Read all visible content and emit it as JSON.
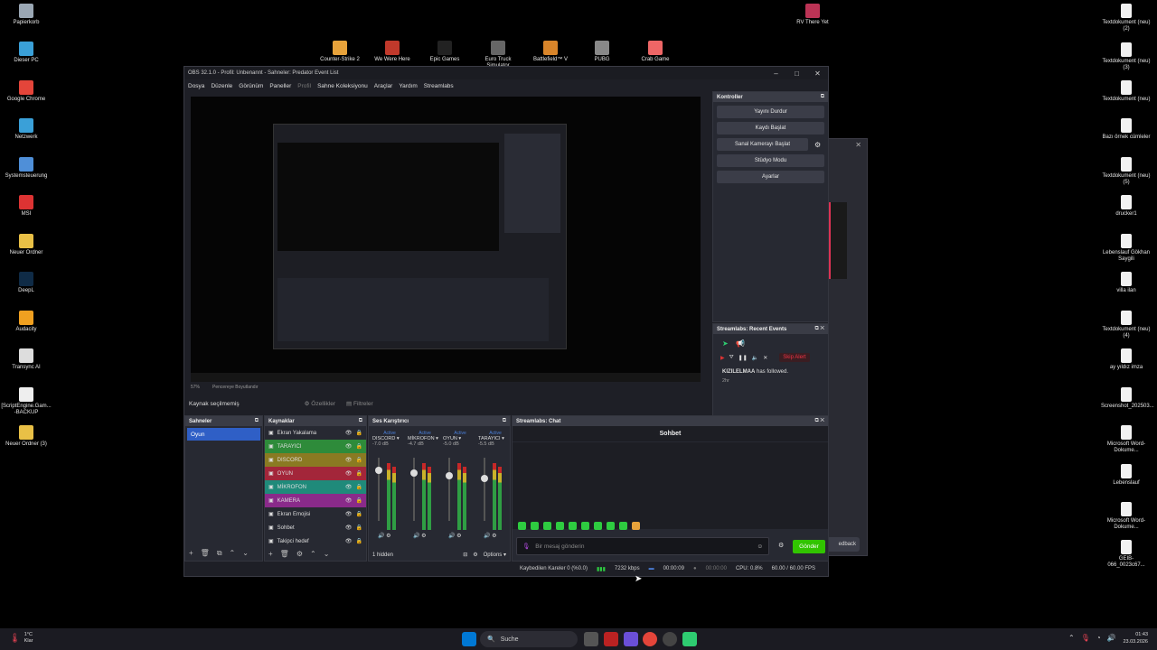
{
  "desktop": {
    "left_icons": [
      {
        "label": "Papierkorb",
        "color": "#9aa7b4"
      },
      {
        "label": "Dieser PC",
        "color": "#3aa0d8"
      },
      {
        "label": "Google Chrome",
        "color": "#e4453a"
      },
      {
        "label": "Netzwerk",
        "color": "#3aa0d8"
      },
      {
        "label": "Systemsteuerung",
        "color": "#4f8fd8"
      },
      {
        "label": "MSI",
        "color": "#d33"
      },
      {
        "label": "Neuer Ordner",
        "color": "#e9c046"
      },
      {
        "label": "DeepL",
        "color": "#0f2b46"
      },
      {
        "label": "Audacity",
        "color": "#f0a020"
      },
      {
        "label": "Transync AI",
        "color": "#ddd"
      },
      {
        "label": "[ScriptEngine.Gam... -BACKUP",
        "color": "#eee"
      },
      {
        "label": "Neuer Ordner (3)",
        "color": "#e9c046"
      }
    ],
    "top_icons": [
      {
        "label": "Counter-Strike 2",
        "color": "#e8a33b"
      },
      {
        "label": "We Were Here",
        "color": "#c0392b"
      },
      {
        "label": "Epic Games",
        "color": "#222"
      },
      {
        "label": "Euro Truck Simulator",
        "color": "#666"
      },
      {
        "label": "Battlefield™ V",
        "color": "#d9852a"
      },
      {
        "label": "PUBG",
        "color": "#888"
      },
      {
        "label": "Crab Game",
        "color": "#e66"
      }
    ],
    "rv_icon": {
      "label": "RV There Yet",
      "color": "#b35"
    },
    "right_icons": [
      {
        "label": "Textdokument (neu) (2)"
      },
      {
        "label": "Textdokument (neu) (3)"
      },
      {
        "label": "Textdokument (neu)"
      },
      {
        "label": "Bazı örnek cümleler"
      },
      {
        "label": "Textdokument (neu) (5)"
      },
      {
        "label": "drucker1"
      },
      {
        "label": "Lebenslauf Gökhan Saygili"
      },
      {
        "label": "villa ilan"
      },
      {
        "label": "Textdokument (neu) (4)"
      },
      {
        "label": "ay yıldız imza"
      },
      {
        "label": "Screenshot_202503..."
      },
      {
        "label": "Microsoft Word-Dokume..."
      },
      {
        "label": "Lebenslauf"
      },
      {
        "label": "Microsoft Word-Dokume..."
      },
      {
        "label": "GEIB-066_0023c67..."
      }
    ]
  },
  "obs": {
    "title": "OBS 32.1.0 - Profil: Unbenannt - Sahneler: Predator Event List",
    "menu": [
      "Dosya",
      "Düzenle",
      "Görünüm",
      "Paneller",
      "Profil",
      "Sahne Koleksiyonu",
      "Araçlar",
      "Yardım",
      "Streamlabs"
    ],
    "source_bar": {
      "text": "Kaynak seçilmemiş",
      "props": "Özellikler",
      "filters": "Filtreler"
    },
    "kontroller": {
      "title": "Kontroller",
      "buttons": [
        "Yayını Durdur",
        "Kaydı Başlat",
        "Sanal Kamerayı Başlat",
        "Stüdyo Modu",
        "Ayarlar"
      ]
    },
    "recent_events": {
      "title": "Streamlabs: Recent Events",
      "skip": "Skip Alert",
      "user": "KIZILELMAA",
      "action": "has followed.",
      "time": "2hr"
    },
    "scenes": {
      "title": "Sahneler",
      "items": [
        "Oyun"
      ]
    },
    "sources": {
      "title": "Kaynaklar",
      "items": [
        {
          "label": "Ekran Yakalama",
          "bg": "transparent"
        },
        {
          "label": "TARAYICI",
          "bg": "#2e8b3a"
        },
        {
          "label": "DISCORD",
          "bg": "#8a7a22"
        },
        {
          "label": "OYUN",
          "bg": "#a3263a"
        },
        {
          "label": "MİKROFON",
          "bg": "#1f8a7a"
        },
        {
          "label": "KAMERA",
          "bg": "#8a2a8a"
        },
        {
          "label": "Ekran Emojisi",
          "bg": "transparent"
        },
        {
          "label": "Sohbet",
          "bg": "transparent"
        },
        {
          "label": "Takipci hedef",
          "bg": "transparent"
        }
      ]
    },
    "mixer": {
      "title": "Ses Karıştırıcı",
      "channels": [
        {
          "name": "DISCORD",
          "db": "-7.0 dB",
          "status": "Active"
        },
        {
          "name": "MİKROFON",
          "db": "-4.7 dB",
          "status": "Active"
        },
        {
          "name": "OYUN",
          "db": "-5.0 dB",
          "status": "Active"
        },
        {
          "name": "TARAYICI",
          "db": "-5.5 dB",
          "status": "Active"
        }
      ],
      "hidden": "1 hidden",
      "options": "Options"
    },
    "chat": {
      "title": "Streamlabs: Chat",
      "header": "Sohbet",
      "placeholder": "Bir mesaj gönderin",
      "send": "Gönder"
    },
    "statusbar": {
      "dropped": "Kaybedilen Kareler 0 (%0.0)",
      "bitrate": "7232 kbps",
      "stream_time": "00:00:09",
      "rec_time": "00:00:00",
      "cpu": "CPU: 0.8%",
      "fps": "60.00 / 60.00 FPS"
    },
    "zoom": "57%",
    "preview_label": "Pencereye Boyutlandır"
  },
  "bg_window": {
    "feedback": "edback"
  },
  "taskbar": {
    "weather_temp": "1°C",
    "weather_text": "Klar",
    "search": "Suche",
    "time": "01:43",
    "date": "23.03.2026"
  }
}
